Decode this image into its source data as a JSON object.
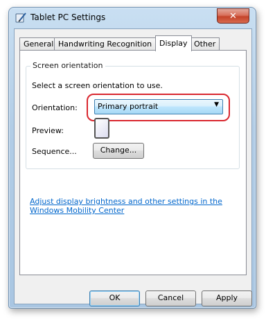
{
  "window": {
    "title": "Tablet PC Settings",
    "icon": "tablet-pen-icon",
    "close_glyph": "✕"
  },
  "tabs": [
    {
      "label": "General",
      "active": false
    },
    {
      "label": "Handwriting Recognition",
      "active": false
    },
    {
      "label": "Display",
      "active": true
    },
    {
      "label": "Other",
      "active": false
    }
  ],
  "screen_orientation": {
    "group_title": "Screen orientation",
    "description": "Select a screen orientation to use.",
    "orientation_label": "Orientation:",
    "orientation_value": "Primary portrait",
    "preview_label": "Preview:",
    "sequence_label": "Sequence...",
    "change_button": "Change..."
  },
  "mobility_link": "Adjust display brightness and other settings in the Windows Mobility Center",
  "buttons": {
    "ok": "OK",
    "cancel": "Cancel",
    "apply": "Apply"
  },
  "colors": {
    "highlight_ring": "#d9262e",
    "link": "#0066cc",
    "close_button": "#c4432a"
  }
}
